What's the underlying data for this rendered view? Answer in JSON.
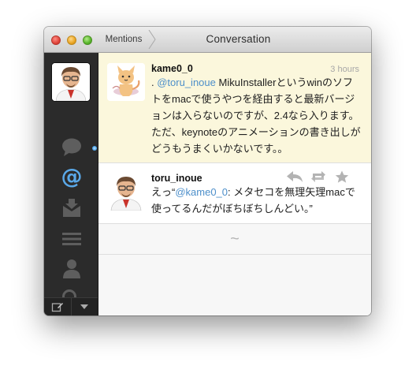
{
  "window": {
    "breadcrumb": "Mentions",
    "title": "Conversation"
  },
  "sidebar": {
    "items": [
      {
        "name": "messages-icon"
      },
      {
        "name": "mentions-icon",
        "active": true
      },
      {
        "name": "direct-messages-icon"
      },
      {
        "name": "lists-icon"
      },
      {
        "name": "profile-icon"
      },
      {
        "name": "search-icon"
      }
    ],
    "bottom": [
      "compose-icon",
      "dropdown-icon"
    ]
  },
  "tweets": [
    {
      "username": "kame0_0",
      "time": "3 hours",
      "prefix": ". ",
      "mention": "@toru_inoue",
      "body": " MikuInstallerというwinのソフトをmacで使うやつを経由すると最新バージョンは入らないのですが、2.4なら入ります。ただ、keynoteのアニメーションの書き出しがどうもうまくいかないです。。"
    },
    {
      "username": "toru_inoue",
      "prefix": "えっ“",
      "mention": "@kame0_0",
      "body": ": メタセコを無理矢理macで使ってるんだがぼちぼちしんどい。”"
    }
  ],
  "more_indicator": "~",
  "colors": {
    "sidebar": "#2b2b2b",
    "highlight_row": "#fbf7dc",
    "mention": "#4d8fca",
    "active_icon": "#5aa8e8"
  }
}
